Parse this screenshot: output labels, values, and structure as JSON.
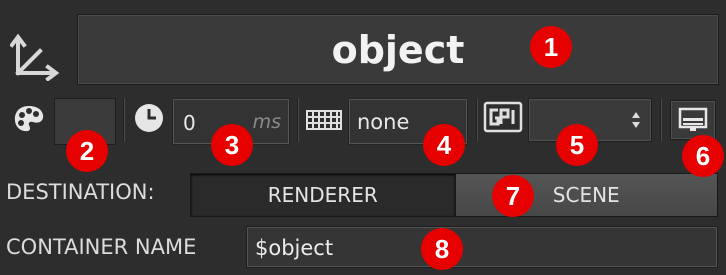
{
  "colors": {
    "panel_bg": "#2d2d2d",
    "field_bg": "#333333",
    "text": "#e6e6e6",
    "marker_red": "#e60000"
  },
  "header": {
    "container_icon": "axis-transform-icon",
    "object_label": "object"
  },
  "toolbar": {
    "palette_icon": "palette-icon",
    "clock_icon": "clock-icon",
    "delay_value": "0",
    "delay_unit": "ms",
    "grid_icon": "keyboard-grid-icon",
    "grid_value": "none",
    "gpi_icon": "gpi-icon",
    "gpi_value": "",
    "monitor_icon": "monitor-icon"
  },
  "destination": {
    "label": "DESTINATION:",
    "options": [
      "RENDERER",
      "SCENE"
    ],
    "selected": "RENDERER"
  },
  "container": {
    "label": "CONTAINER NAME",
    "value": "$object"
  },
  "markers": [
    "1",
    "2",
    "3",
    "4",
    "5",
    "6",
    "7",
    "8"
  ]
}
